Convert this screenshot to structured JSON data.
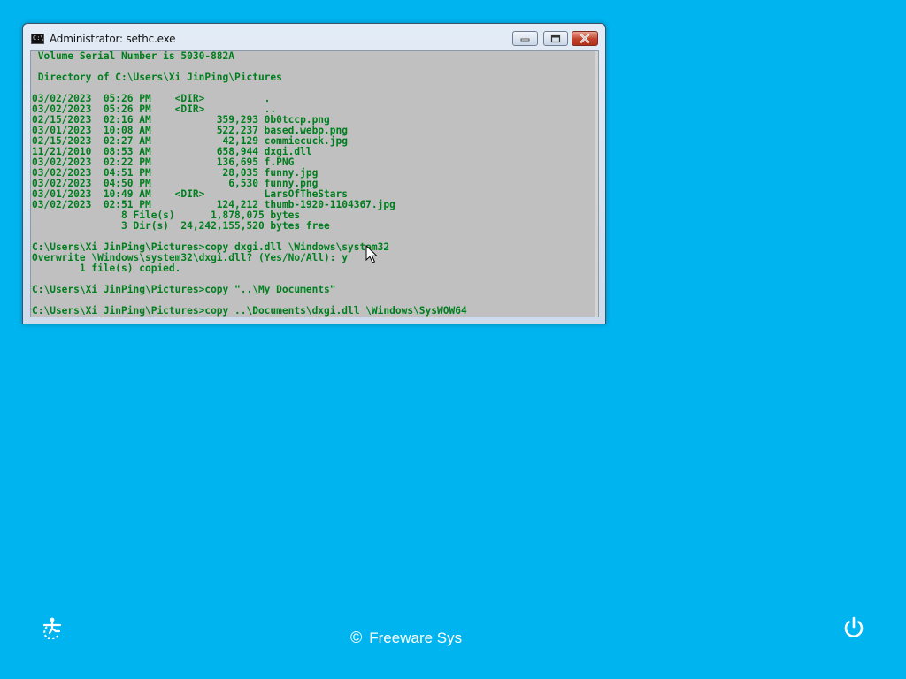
{
  "desktop": {
    "background_color": "#00b4f0"
  },
  "window": {
    "title": "Administrator: sethc.exe",
    "app_icon_text": "C:\\",
    "controls": [
      "minimize",
      "maximize",
      "close"
    ]
  },
  "console": {
    "text_color": "#007e1e",
    "background_color": "#c0c0c0",
    "lines": [
      " Volume Serial Number is 5030-882A",
      "",
      " Directory of C:\\Users\\Xi JinPing\\Pictures",
      "",
      "03/02/2023  05:26 PM    <DIR>          .",
      "03/02/2023  05:26 PM    <DIR>          ..",
      "02/15/2023  02:16 AM           359,293 0b0tccp.png",
      "03/01/2023  10:08 AM           522,237 based.webp.png",
      "02/15/2023  02:27 AM            42,129 commiecuck.jpg",
      "11/21/2010  08:53 AM           658,944 dxgi.dll",
      "03/02/2023  02:22 PM           136,695 f.PNG",
      "03/02/2023  04:51 PM            28,035 funny.jpg",
      "03/02/2023  04:50 PM             6,530 funny.png",
      "03/01/2023  10:49 AM    <DIR>          LarsOfTheStars",
      "03/02/2023  02:51 PM           124,212 thumb-1920-1104367.jpg",
      "               8 File(s)      1,878,075 bytes",
      "               3 Dir(s)  24,242,155,520 bytes free",
      "",
      "C:\\Users\\Xi JinPing\\Pictures>copy dxgi.dll \\Windows\\system32",
      "Overwrite \\Windows\\system32\\dxgi.dll? (Yes/No/All): y",
      "        1 file(s) copied.",
      "",
      "C:\\Users\\Xi JinPing\\Pictures>copy \"..\\My Documents\"",
      "",
      "C:\\Users\\Xi JinPing\\Pictures>copy ..\\Documents\\dxgi.dll \\Windows\\SysWOW64"
    ]
  },
  "footer": {
    "copyright_symbol": "©",
    "brand_text": "Freeware Sys",
    "left_icon": "ease-of-access-icon",
    "right_icon": "power-icon"
  }
}
